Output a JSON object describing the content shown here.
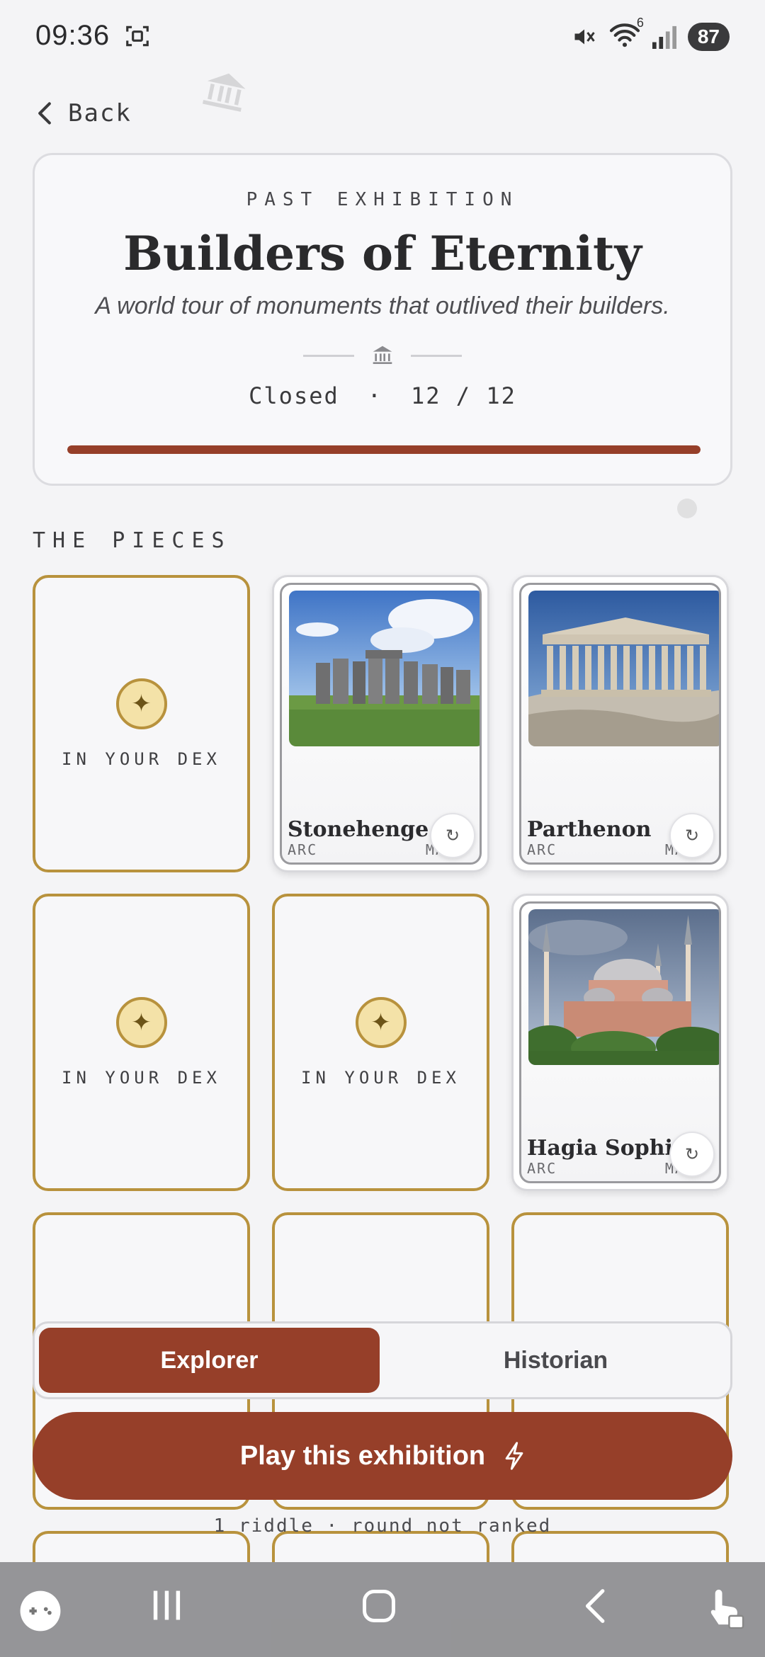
{
  "status_bar": {
    "time": "09:36",
    "battery": "87",
    "wifi_superscript": "6"
  },
  "nav": {
    "back_label": "Back"
  },
  "exhibition": {
    "kicker": "PAST EXHIBITION",
    "title": "Builders of Eternity",
    "subtitle": "A world tour of monuments that outlived their builders.",
    "status": "Closed",
    "separator": "·",
    "count": "12 / 12",
    "progress_fraction": 1.0,
    "accent_color": "#963f29"
  },
  "pieces_section": {
    "label": "THE PIECES",
    "tiles": [
      {
        "type": "dex",
        "label": "IN YOUR DEX"
      },
      {
        "type": "piece",
        "name": "Stonehenge",
        "tag_left": "ARC",
        "tag_right": "MA"
      },
      {
        "type": "piece",
        "name": "Parthenon",
        "tag_left": "ARC",
        "tag_right": "MA"
      },
      {
        "type": "dex",
        "label": "IN YOUR DEX"
      },
      {
        "type": "dex",
        "label": "IN YOUR DEX"
      },
      {
        "type": "piece",
        "name": "Hagia Sophia",
        "tag_left": "ARC",
        "tag_right": "MA"
      }
    ]
  },
  "mode_toggle": {
    "options": [
      "Explorer",
      "Historian"
    ],
    "selected": "Explorer"
  },
  "play_button": {
    "label": "Play this exhibition"
  },
  "footnote": "1 riddle · round not ranked"
}
